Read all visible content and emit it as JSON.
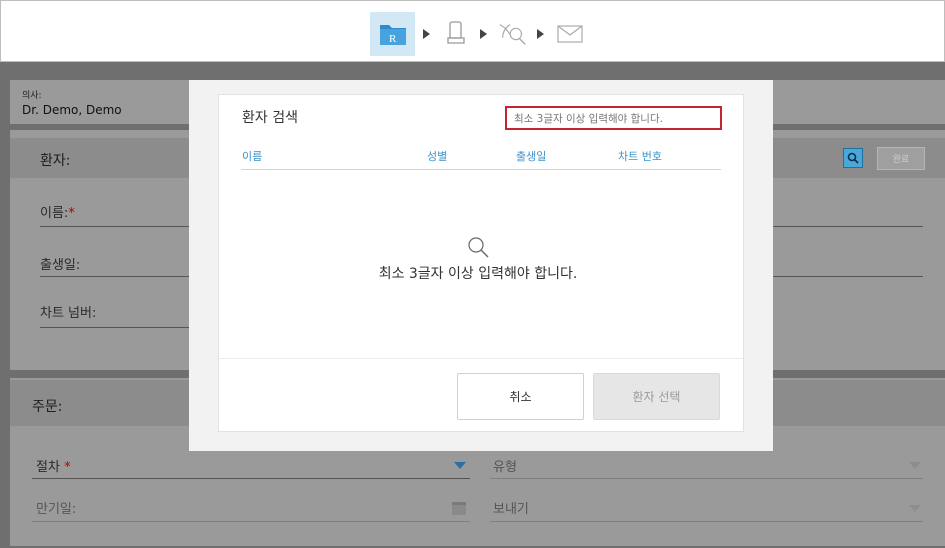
{
  "workflow": {
    "steps": [
      {
        "icon": "rx-folder-icon",
        "label": "R",
        "active": true
      },
      {
        "icon": "scanner-wand-icon"
      },
      {
        "icon": "view-tooth-icon"
      },
      {
        "icon": "send-envelope-icon"
      }
    ]
  },
  "doctor": {
    "label": "의사:",
    "value": "Dr. Demo, Demo"
  },
  "patient_section": {
    "title": "환자:",
    "done_label": "완료",
    "fields": [
      {
        "label": "이름:",
        "required": "*"
      },
      {
        "label": "출생일:"
      },
      {
        "label": "차트 넘버:"
      }
    ]
  },
  "order_section": {
    "title": "주문:",
    "procedure_label": "절차",
    "procedure_required": "*",
    "type_label": "유형",
    "due_label": "만기일:",
    "send_label": "보내기"
  },
  "modal": {
    "title": "환자 검색",
    "hint": "최소 3글자 이상 입력해야 합니다.",
    "columns": [
      "이름",
      "성별",
      "출생일",
      "차트 번호"
    ],
    "empty_message": "최소 3글자 이상 입력해야 합니다.",
    "cancel_label": "취소",
    "select_label": "환자 선택"
  },
  "colors": {
    "accent": "#3c94cc",
    "highlight_border": "#c1272d",
    "active_step_bg": "#d3e8f5"
  }
}
